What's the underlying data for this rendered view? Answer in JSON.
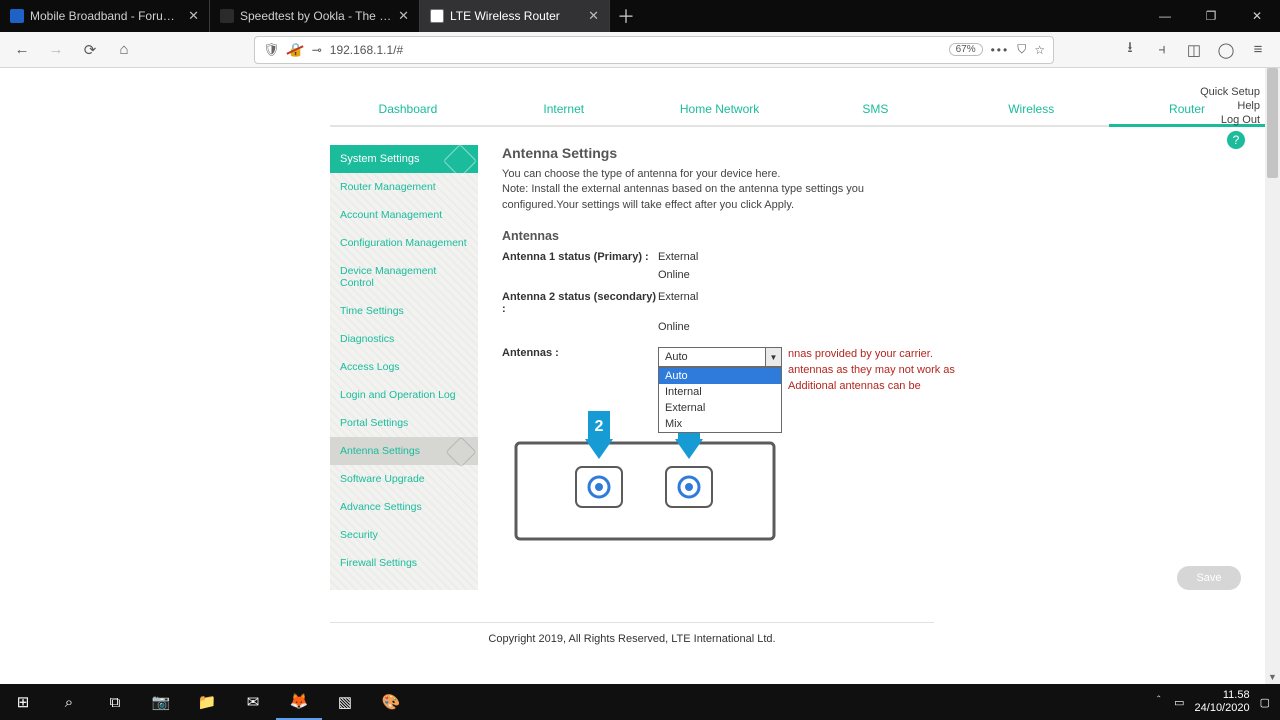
{
  "browser": {
    "tabs": [
      {
        "label": "Mobile Broadband - Forum | K…",
        "favicon": "#1e62c8"
      },
      {
        "label": "Speedtest by Ookla - The Glob…",
        "favicon": "#2b2b2b"
      },
      {
        "label": "LTE Wireless Router",
        "favicon": "#ffffff"
      }
    ],
    "url": "192.168.1.1/#",
    "zoom": "67%"
  },
  "corner": {
    "quick": "Quick Setup",
    "help": "Help",
    "logout": "Log Out"
  },
  "nav": [
    "Dashboard",
    "Internet",
    "Home Network",
    "SMS",
    "Wireless",
    "Router"
  ],
  "nav_active": 5,
  "sidebar": {
    "header": "System Settings",
    "items": [
      "Router Management",
      "Account Management",
      "Configuration Management",
      "Device Management Control",
      "Time Settings",
      "Diagnostics",
      "Access Logs",
      "Login and Operation Log",
      "Portal Settings",
      "Antenna Settings",
      "Software Upgrade",
      "Advance Settings",
      "Security",
      "Firewall Settings"
    ],
    "active": 9
  },
  "content": {
    "title": "Antenna Settings",
    "desc1": "You can choose the type of antenna for your device here.",
    "desc2": "Note: Install the external antennas based on the antenna type settings you configured.Your settings will take effect after you click Apply.",
    "sub": "Antennas",
    "a1label": "Antenna 1 status (Primary) :",
    "a1type": "External",
    "a1state": "Online",
    "a2label": "Antenna 2 status (secondary) :",
    "a2type": "External",
    "a2state": "Online",
    "ddlabel": "Antennas :",
    "ddvalue": "Auto",
    "ddoptions": [
      "Auto",
      "Internal",
      "External",
      "Mix"
    ],
    "warn1": "nnas provided by your carrier.",
    "warn2": "antennas as they may not work as",
    "warn3": "Additional antennas can be",
    "save": "Save"
  },
  "footer": "Copyright 2019, All Rights Reserved, LTE International Ltd.",
  "tray": {
    "time": "11.58",
    "date": "24/10/2020"
  }
}
